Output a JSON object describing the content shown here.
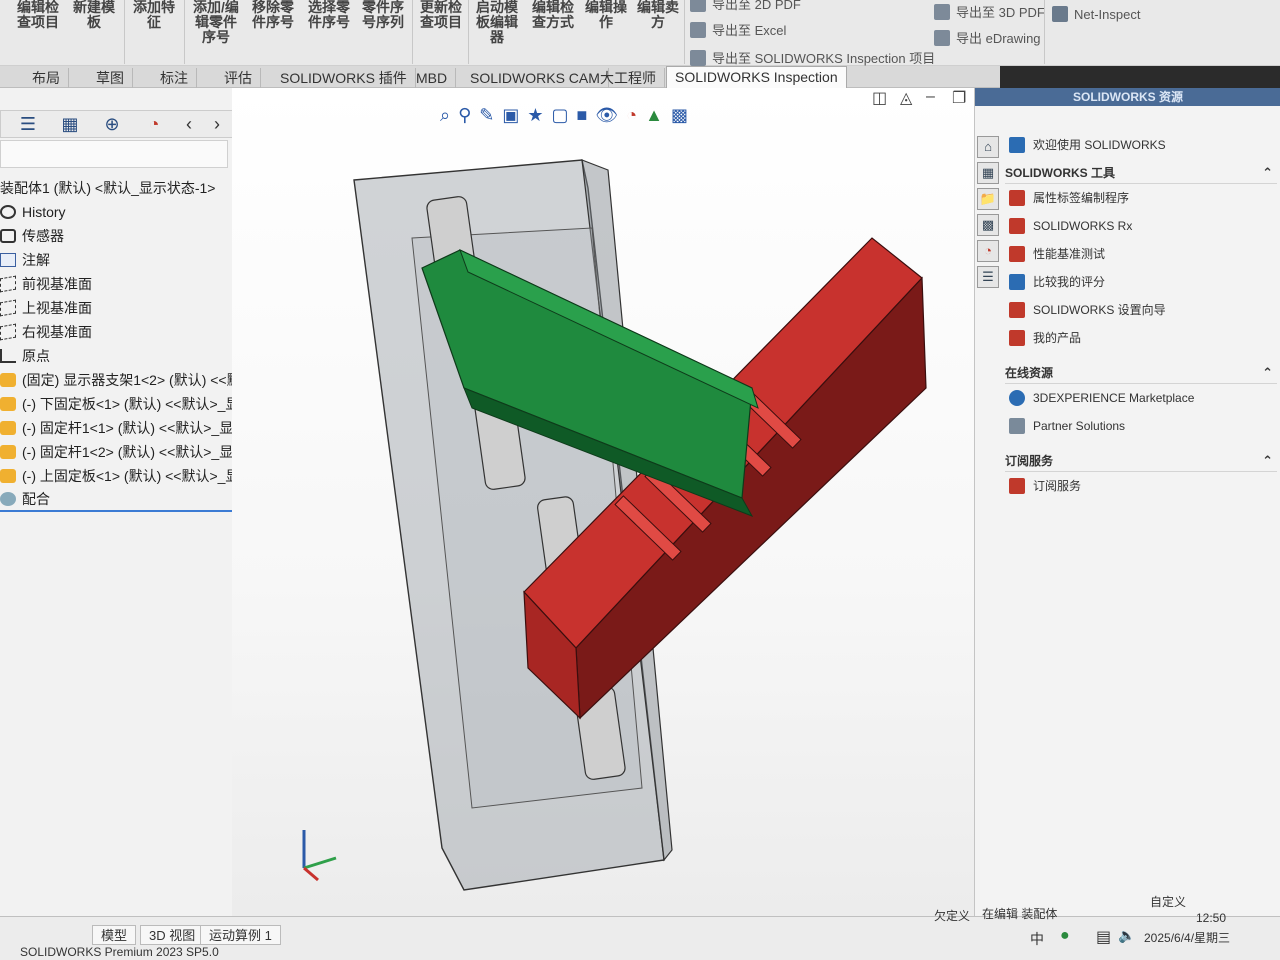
{
  "ribbon": {
    "buttons": [
      "编辑检\n查项目",
      "新建模\n板",
      "添加特\n征",
      "添加/编\n辑零件\n序号",
      "移除零\n件序号",
      "选择零\n件序号",
      "零件序\n号序列",
      "更新检\n查项目",
      "启动模\n板编辑\n器",
      "编辑检\n查方式",
      "编辑操\n作",
      "编辑卖\n方"
    ],
    "exports": [
      "导出至 2D PDF",
      "导出至 3D PDF",
      "导出至 Excel",
      "导出 eDrawing",
      "导出至 SOLIDWORKS Inspection 项目"
    ],
    "net_inspect": "Net-Inspect"
  },
  "tabs": [
    "布局",
    "草图",
    "标注",
    "评估",
    "SOLIDWORKS 插件",
    "MBD",
    "SOLIDWORKS CAM",
    "大工程师",
    "SOLIDWORKS Inspection"
  ],
  "feature_manager": {
    "root": "装配体1 (默认) <默认_显示状态-1>",
    "items": [
      {
        "label": "History",
        "icon": "history-icon"
      },
      {
        "label": "传感器",
        "icon": "sensor-icon"
      },
      {
        "label": "注解",
        "icon": "annotation-icon"
      },
      {
        "label": "前视基准面",
        "icon": "plane-icon"
      },
      {
        "label": "上视基准面",
        "icon": "plane-icon"
      },
      {
        "label": "右视基准面",
        "icon": "plane-icon"
      },
      {
        "label": "原点",
        "icon": "origin-icon"
      },
      {
        "label": "(固定) 显示器支架1<2> (默认) <<默",
        "icon": "part-icon"
      },
      {
        "label": "(-) 下固定板<1> (默认) <<默认>_显",
        "icon": "part-icon"
      },
      {
        "label": "(-) 固定杆1<1> (默认) <<默认>_显",
        "icon": "part-icon"
      },
      {
        "label": "(-) 固定杆1<2> (默认) <<默认>_显",
        "icon": "part-icon"
      },
      {
        "label": "(-) 上固定板<1> (默认) <<默认>_显",
        "icon": "part-icon"
      },
      {
        "label": "配合",
        "icon": "mate-icon"
      }
    ]
  },
  "task_pane": {
    "header": "SOLIDWORKS 资源",
    "welcome": "欢迎使用 SOLIDWORKS",
    "sections": [
      {
        "title": "SOLIDWORKS 工具",
        "items": [
          "属性标签编制程序",
          "SOLIDWORKS Rx",
          "性能基准测试",
          "比较我的评分",
          "SOLIDWORKS 设置向导",
          "我的产品"
        ]
      },
      {
        "title": "在线资源",
        "items": [
          "3DEXPERIENCE Marketplace",
          "Partner Solutions"
        ]
      },
      {
        "title": "订阅服务",
        "items": [
          "订阅服务"
        ]
      }
    ]
  },
  "bottom": {
    "tabs": [
      "模型",
      "3D 视图",
      "运动算例 1"
    ],
    "app_version": "SOLIDWORKS Premium 2023 SP5.0",
    "status_underdefined": "欠定义",
    "status_editing": "在编辑 装配体",
    "status_custom": "自定义",
    "clock_time": "12:50",
    "clock_date": "2025/6/4/星期三",
    "ime": "中"
  },
  "colors": {
    "rack": "#c8322e",
    "green_plate": "#1f8a3e",
    "bracket": "#9aa0a6"
  }
}
